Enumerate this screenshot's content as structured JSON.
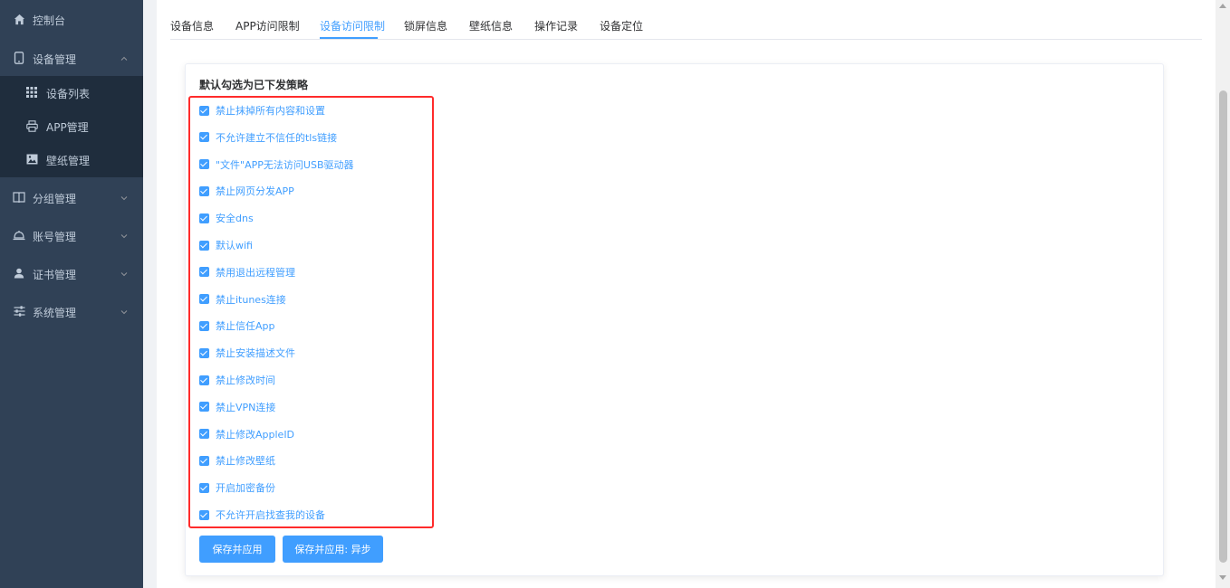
{
  "sidebar": {
    "items": [
      {
        "label": "控制台",
        "icon": "home-icon"
      },
      {
        "label": "设备管理",
        "icon": "tablet-icon",
        "expanded": true
      },
      {
        "label": "分组管理",
        "icon": "book-icon"
      },
      {
        "label": "账号管理",
        "icon": "bell-icon"
      },
      {
        "label": "证书管理",
        "icon": "user-icon"
      },
      {
        "label": "系统管理",
        "icon": "sliders-icon"
      }
    ],
    "subitems": [
      {
        "label": "设备列表",
        "icon": "grid-icon"
      },
      {
        "label": "APP管理",
        "icon": "printer-icon"
      },
      {
        "label": "壁纸管理",
        "icon": "image-icon"
      }
    ]
  },
  "tabs": [
    {
      "label": "设备信息"
    },
    {
      "label": "APP访问限制"
    },
    {
      "label": "设备访问限制",
      "active": true
    },
    {
      "label": "锁屏信息"
    },
    {
      "label": "壁纸信息"
    },
    {
      "label": "操作记录"
    },
    {
      "label": "设备定位"
    }
  ],
  "card": {
    "title": "默认勾选为已下发策略",
    "policies": [
      {
        "label": "禁止抹掉所有内容和设置",
        "checked": true
      },
      {
        "label": "不允许建立不信任的tls链接",
        "checked": true
      },
      {
        "label": "\"文件\"APP无法访问USB驱动器",
        "checked": true
      },
      {
        "label": "禁止网页分发APP",
        "checked": true
      },
      {
        "label": "安全dns",
        "checked": true
      },
      {
        "label": "默认wifi",
        "checked": true
      },
      {
        "label": "禁用退出远程管理",
        "checked": true
      },
      {
        "label": "禁止itunes连接",
        "checked": true
      },
      {
        "label": "禁止信任App",
        "checked": true
      },
      {
        "label": "禁止安装描述文件",
        "checked": true
      },
      {
        "label": "禁止修改时间",
        "checked": true
      },
      {
        "label": "禁止VPN连接",
        "checked": true
      },
      {
        "label": "禁止修改AppleID",
        "checked": true
      },
      {
        "label": "禁止修改壁纸",
        "checked": true
      },
      {
        "label": "开启加密备份",
        "checked": true
      },
      {
        "label": "不允许开启找查我的设备",
        "checked": true
      }
    ],
    "buttons": {
      "save_apply": "保存并应用",
      "save_apply_async": "保存并应用: 异步"
    }
  },
  "colors": {
    "sidebar_bg": "#304156",
    "submenu_bg": "#1f2d3d",
    "accent": "#409eff",
    "highlight_border": "#ff2b2b"
  }
}
